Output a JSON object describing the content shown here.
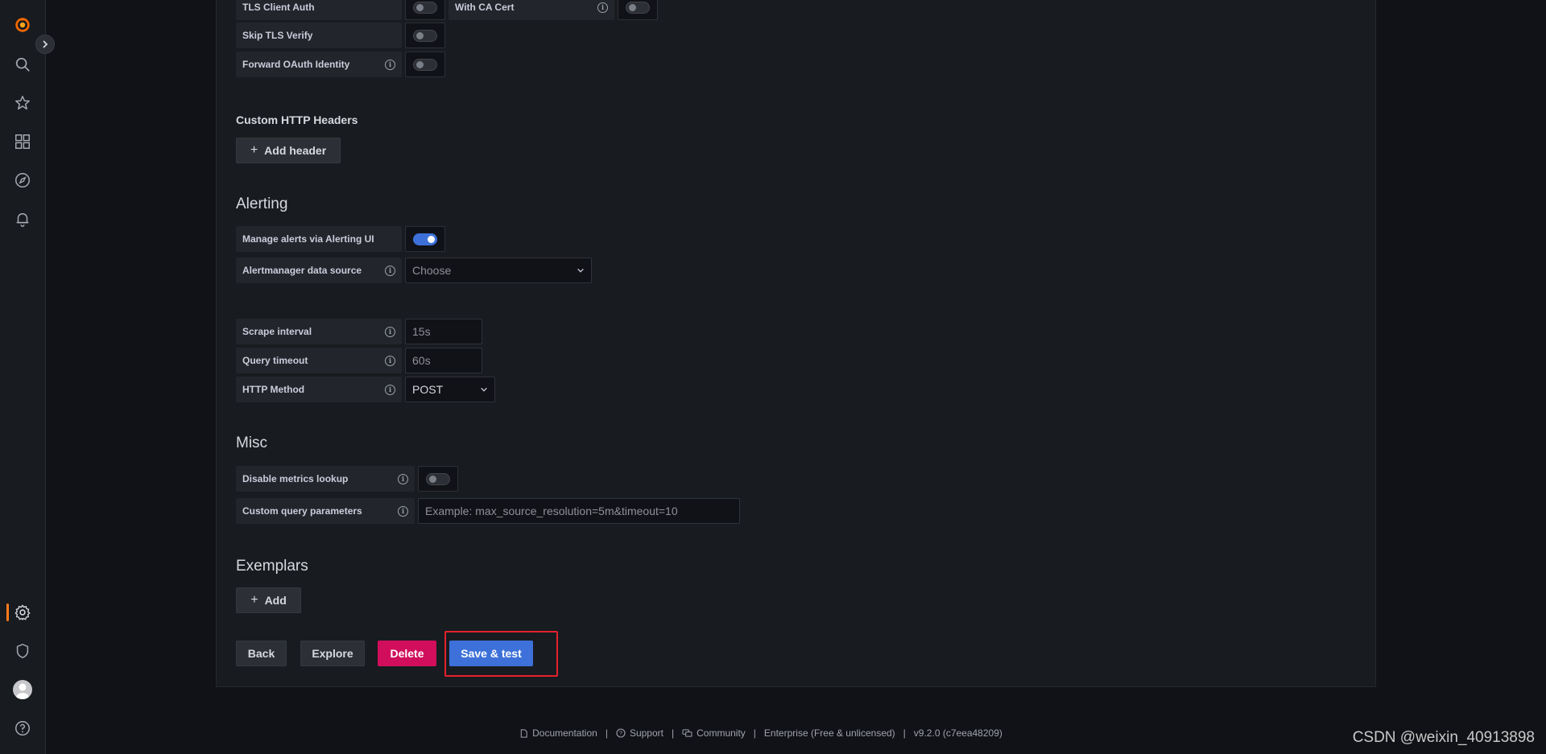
{
  "colors": {
    "accent": "#3d71d9",
    "danger": "#d10e5c",
    "active": "#ff7a1a",
    "highlight": "#e5212d"
  },
  "nav": {
    "icons": [
      "grafana-logo-icon",
      "search-icon",
      "star-icon",
      "dashboards-icon",
      "explore-icon",
      "alerting-icon",
      "gear-icon",
      "shield-icon",
      "avatar",
      "help-icon"
    ]
  },
  "tls": {
    "client_auth_label": "TLS Client Auth",
    "with_ca_cert_label": "With CA Cert",
    "skip_verify_label": "Skip TLS Verify",
    "forward_oauth_label": "Forward OAuth Identity"
  },
  "headers": {
    "title": "Custom HTTP Headers",
    "add_label": "Add header"
  },
  "alerting": {
    "title": "Alerting",
    "manage_label": "Manage alerts via Alerting UI",
    "manage_enabled": true,
    "alertmanager_label": "Alertmanager data source",
    "alertmanager_placeholder": "Choose"
  },
  "settings": {
    "scrape_label": "Scrape interval",
    "scrape_placeholder": "15s",
    "timeout_label": "Query timeout",
    "timeout_placeholder": "60s",
    "method_label": "HTTP Method",
    "method_value": "POST"
  },
  "misc": {
    "title": "Misc",
    "disable_lookup_label": "Disable metrics lookup",
    "custom_params_label": "Custom query parameters",
    "custom_params_placeholder": "Example: max_source_resolution=5m&timeout=10"
  },
  "exemplars": {
    "title": "Exemplars",
    "add_label": "Add"
  },
  "actions": {
    "back": "Back",
    "explore": "Explore",
    "delete": "Delete",
    "save": "Save & test"
  },
  "footer": {
    "documentation": "Documentation",
    "support": "Support",
    "community": "Community",
    "edition": "Enterprise (Free & unlicensed)",
    "version": "v9.2.0 (c7eea48209)"
  },
  "watermark": "CSDN @weixin_40913898"
}
